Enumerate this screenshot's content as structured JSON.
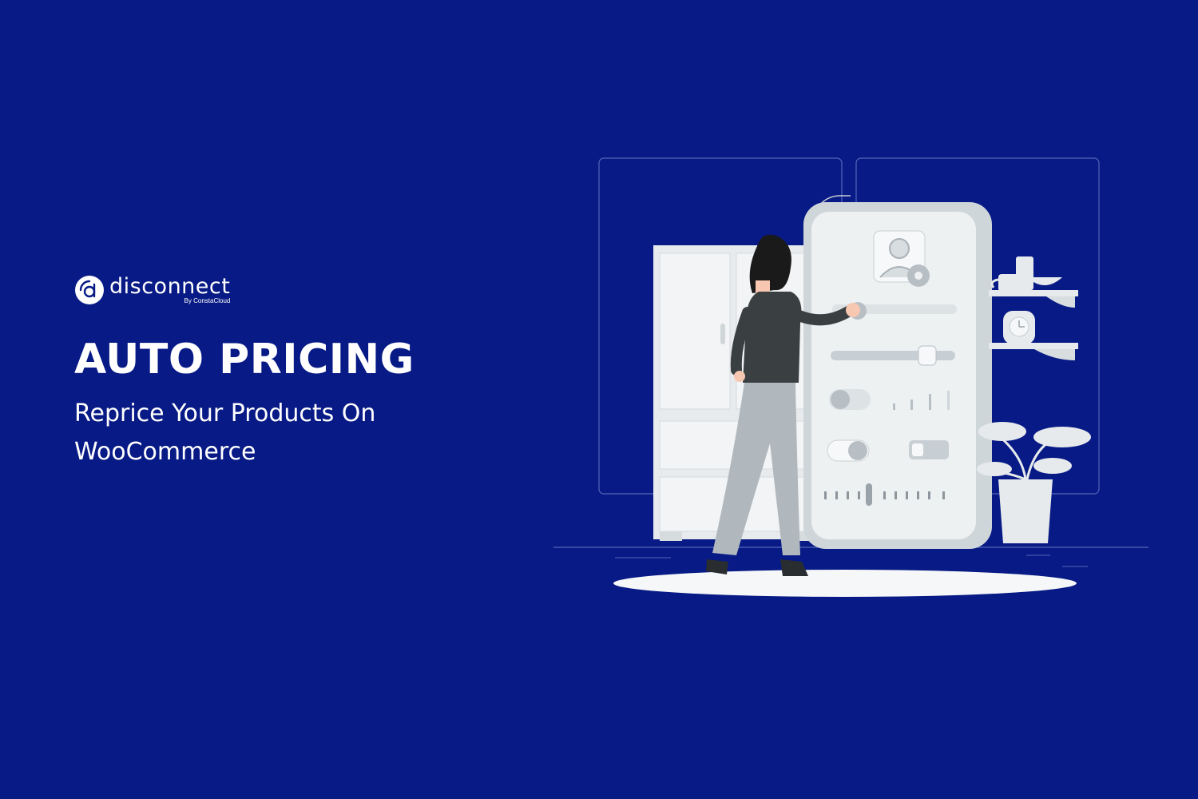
{
  "brand": {
    "name": "disconnect",
    "byline": "By ConstaCloud",
    "logo_icon": "disconnect-logo-icon"
  },
  "hero": {
    "title": "AUTO PRICING",
    "subtitle_line1": "Reprice Your Products On",
    "subtitle_line2": "WooCommerce"
  },
  "illustration": {
    "icon": "pricing-settings-illustration"
  },
  "colors": {
    "background": "#071a85",
    "text": "#ffffff",
    "illustration_fill": "#eceff1",
    "illustration_gray": "#b0b8be",
    "figure_shirt": "#3a3f42"
  }
}
